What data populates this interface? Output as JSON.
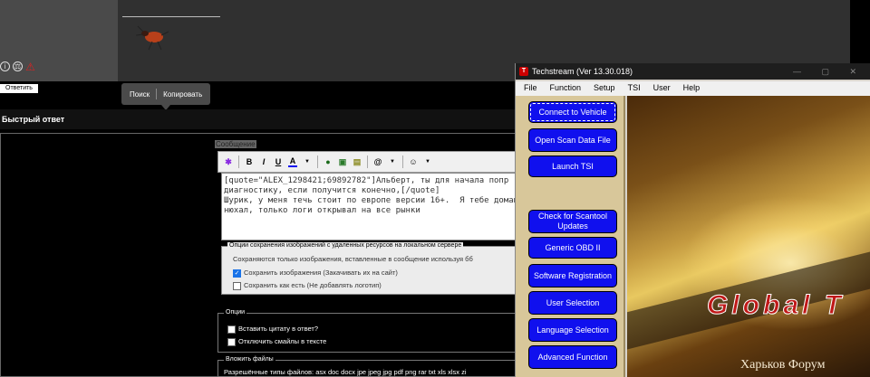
{
  "forum": {
    "post_icons": [
      "info-icon",
      "scales-icon",
      "warning-icon"
    ],
    "reply_small_label": "Ответить",
    "tooltip": {
      "search": "Поиск",
      "copy": "Копировать"
    },
    "quick_reply_title": "Быстрый ответ",
    "message_label": "Сообщение",
    "toolbar": {
      "bold": "B",
      "italic": "I",
      "underline": "U",
      "font_color": "A",
      "icons": [
        "magic-wand-icon",
        "link-icon",
        "image-icon",
        "quote-icon",
        "attachment-icon",
        "smiley-icon"
      ]
    },
    "editor_text": "[quote=\"ALEX_1298421;69892782\"]Альберт, ты для начала попр\nдиагностику, если получится конечно,[/quote]\nШурик, у меня течь стоит по европе версии 16+.  Я тебе домаш\nнюхал, только логи открывал на все рынки",
    "image_options": {
      "legend": "Опции сохранения изображений с удаленных ресурсов на локальном сервере",
      "description": "Сохраняются только изображения, вставленные в сообщение используя бб",
      "save_images": "Сохранить изображения (Закачивать их на сайт)",
      "save_as_is": "Сохранить как есть (Не добавлять логотип)"
    },
    "options": {
      "legend": "Опции",
      "insert_quote": "Вставить цитату в ответ?",
      "disable_smilies": "Отключить смайлы в тексте"
    },
    "attach": {
      "legend": "Вложить файлы",
      "allowed_types": "Разрешённые типы файлов: asx doc docx jpe jpeg jpg pdf png rar txt xls xlsx zi"
    }
  },
  "techstream": {
    "title": "Techstream (Ver 13.30.018)",
    "menu": [
      "File",
      "Function",
      "Setup",
      "TSI",
      "User",
      "Help"
    ],
    "buttons": [
      "Connect to Vehicle",
      "Open Scan Data File",
      "Launch TSI",
      "Check for Scantool Updates",
      "Generic OBD II",
      "Software Registration",
      "User Selection",
      "Language Selection",
      "Advanced Function"
    ],
    "brand_text": "Global T",
    "watermark": "Харьков Форум"
  },
  "colors": {
    "button_blue": "#1010ee",
    "sidebar_tan": "#d8c79a",
    "brand_red": "#c01818"
  }
}
